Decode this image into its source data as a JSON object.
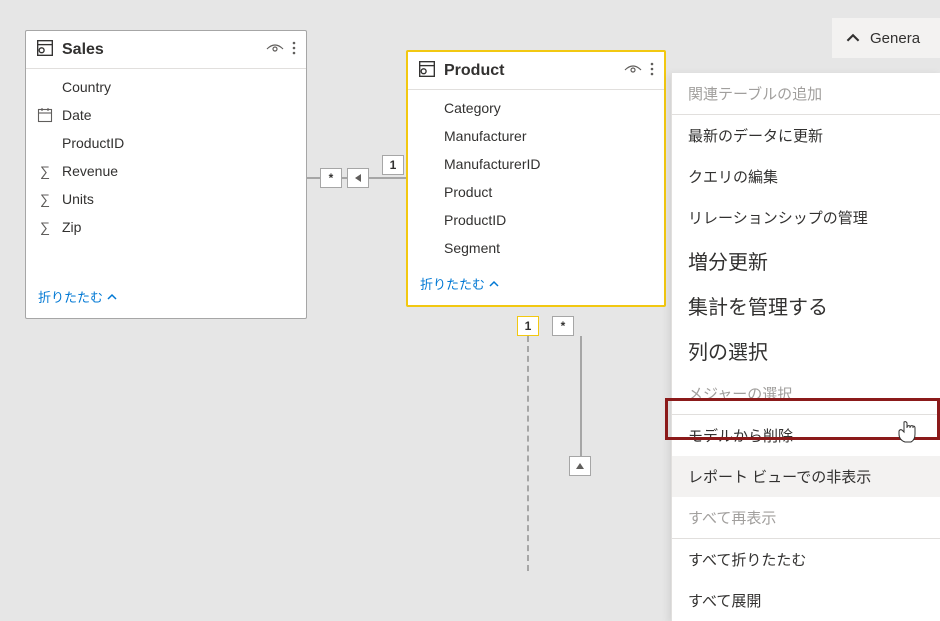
{
  "inspector": {
    "title": "Genera"
  },
  "tables": {
    "sales": {
      "title": "Sales",
      "collapse": "折りたたむ",
      "fields": [
        {
          "icon": "",
          "name": "Country"
        },
        {
          "icon": "date",
          "name": "Date"
        },
        {
          "icon": "",
          "name": "ProductID"
        },
        {
          "icon": "sigma",
          "name": "Revenue"
        },
        {
          "icon": "sigma",
          "name": "Units"
        },
        {
          "icon": "sigma",
          "name": "Zip"
        }
      ]
    },
    "product": {
      "title": "Product",
      "collapse": "折りたたむ",
      "fields": [
        {
          "icon": "",
          "name": "Category"
        },
        {
          "icon": "",
          "name": "Manufacturer"
        },
        {
          "icon": "",
          "name": "ManufacturerID"
        },
        {
          "icon": "",
          "name": "Product"
        },
        {
          "icon": "",
          "name": "ProductID"
        },
        {
          "icon": "",
          "name": "Segment"
        }
      ]
    }
  },
  "relations": {
    "many": "*",
    "one": "1"
  },
  "context_menu": {
    "items": [
      {
        "label": "関連テーブルの追加",
        "disabled": true
      },
      {
        "label": "最新のデータに更新"
      },
      {
        "label": "クエリの編集"
      },
      {
        "label": "リレーションシップの管理"
      },
      {
        "label": "増分更新",
        "big": true
      },
      {
        "label": "集計を管理する",
        "big": true
      },
      {
        "label": "列の選択",
        "big": true
      },
      {
        "label": "メジャーの選択",
        "disabled": true
      },
      {
        "label": "モデルから削除"
      },
      {
        "label": "レポート ビューでの非表示",
        "highlighted": true
      },
      {
        "label": "すべて再表示",
        "disabled": true
      },
      {
        "label": "すべて折りたたむ"
      },
      {
        "label": "すべて展開"
      }
    ]
  }
}
